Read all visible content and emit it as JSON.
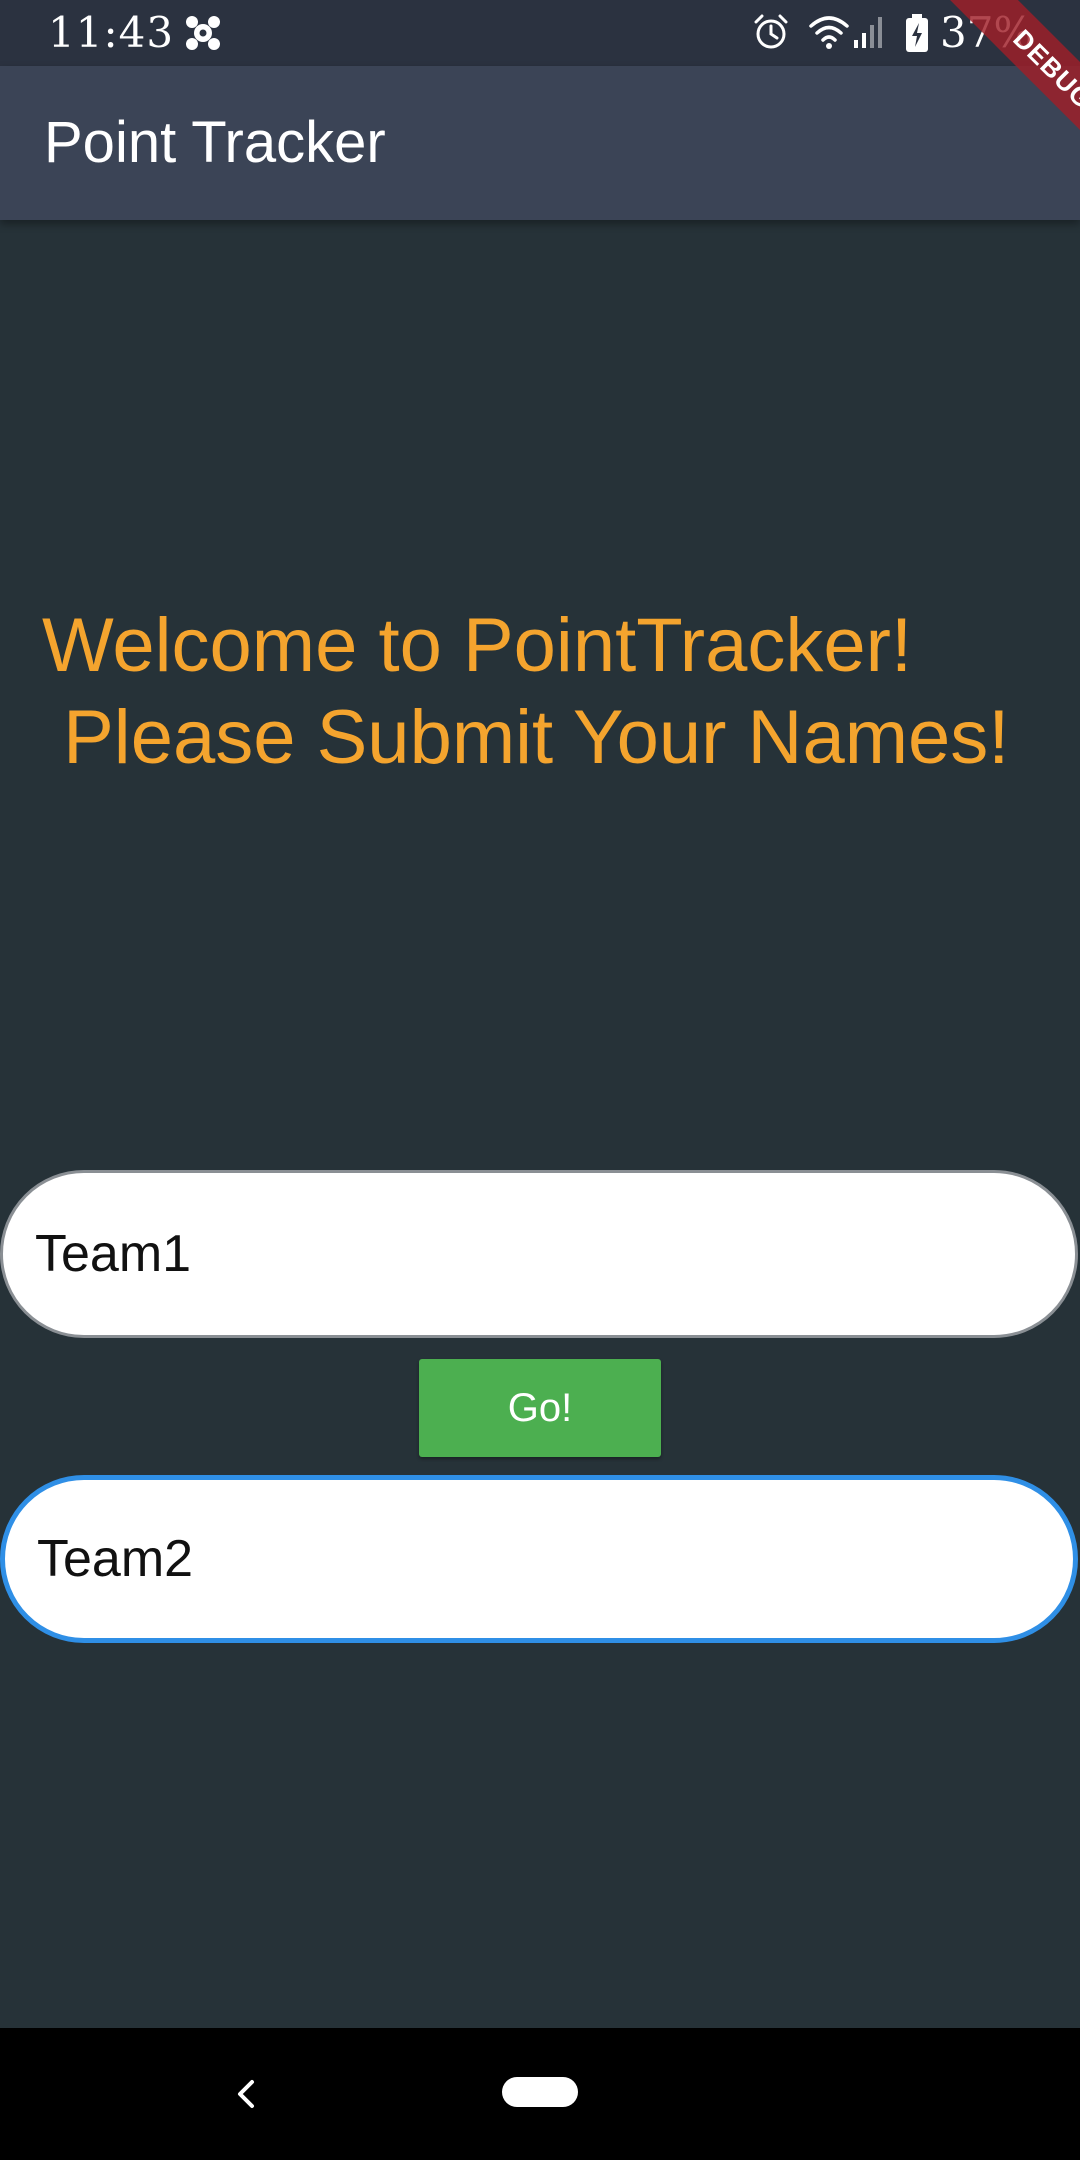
{
  "status_bar": {
    "time": "11:43",
    "battery_text": "37%",
    "icons": [
      "app-notification-icon",
      "alarm-icon",
      "wifi-icon",
      "signal-icon",
      "battery-charging-icon"
    ]
  },
  "app_bar": {
    "title": "Point Tracker"
  },
  "debug_banner": {
    "label": "DEBUG"
  },
  "welcome": {
    "line1": "Welcome to PointTracker!",
    "line2": " Please Submit Your Names!"
  },
  "form": {
    "team1_value": "Team1",
    "team2_value": "Team2",
    "go_label": "Go!"
  },
  "nav_bar": {
    "icons": [
      "back-icon",
      "home-pill-icon"
    ]
  },
  "colors": {
    "background": "#263238",
    "app_bar": "#3b4456",
    "status_bar": "#2b3240",
    "accent_text": "#f4a42e",
    "button": "#4caf50",
    "focused_border": "#2f8fe6",
    "debug_banner": "#a01e28"
  }
}
